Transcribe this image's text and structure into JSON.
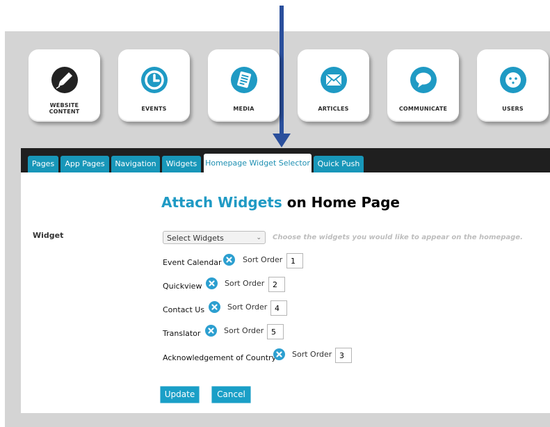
{
  "tiles": [
    {
      "label_line1": "WEBSITE",
      "label_line2": "CONTENT",
      "icon": "pen-icon",
      "color": "#222222"
    },
    {
      "label_line1": "EVENTS",
      "icon": "clock-icon",
      "color": "#1f9ac4"
    },
    {
      "label_line1": "MEDIA",
      "icon": "document-icon",
      "color": "#1f9ac4"
    },
    {
      "label_line1": "ARTICLES",
      "icon": "envelope-icon",
      "color": "#1f9ac4"
    },
    {
      "label_line1": "COMMUNICATE",
      "icon": "speech-bubble-icon",
      "color": "#1f9ac4"
    },
    {
      "label_line1": "USERS",
      "icon": "user-face-icon",
      "color": "#1f9ac4"
    }
  ],
  "tabs": [
    {
      "label": "Pages"
    },
    {
      "label": "App Pages"
    },
    {
      "label": "Navigation"
    },
    {
      "label": "Widgets"
    },
    {
      "label": "Homepage Widget Selector",
      "active": true
    },
    {
      "label": "Quick Push"
    }
  ],
  "heading": {
    "accent": "Attach Widgets",
    "rest": " on Home Page"
  },
  "form": {
    "field_label": "Widget",
    "select_value": "Select Widgets",
    "hint": "Choose the widgets you would like to appear on the homepage.",
    "sort_label": "Sort Order",
    "rows": [
      {
        "name": "Event Calendar",
        "sort": "1"
      },
      {
        "name": "Quickview",
        "sort": "2"
      },
      {
        "name": "Contact Us",
        "sort": "4"
      },
      {
        "name": "Translator",
        "sort": "5"
      },
      {
        "name": "Acknowledgement of Country",
        "sort": "3"
      }
    ]
  },
  "buttons": {
    "update": "Update",
    "cancel": "Cancel"
  },
  "colors": {
    "accent": "#1f9ac4",
    "tab": "#1897b9",
    "arrow": "#2a4f9c"
  }
}
